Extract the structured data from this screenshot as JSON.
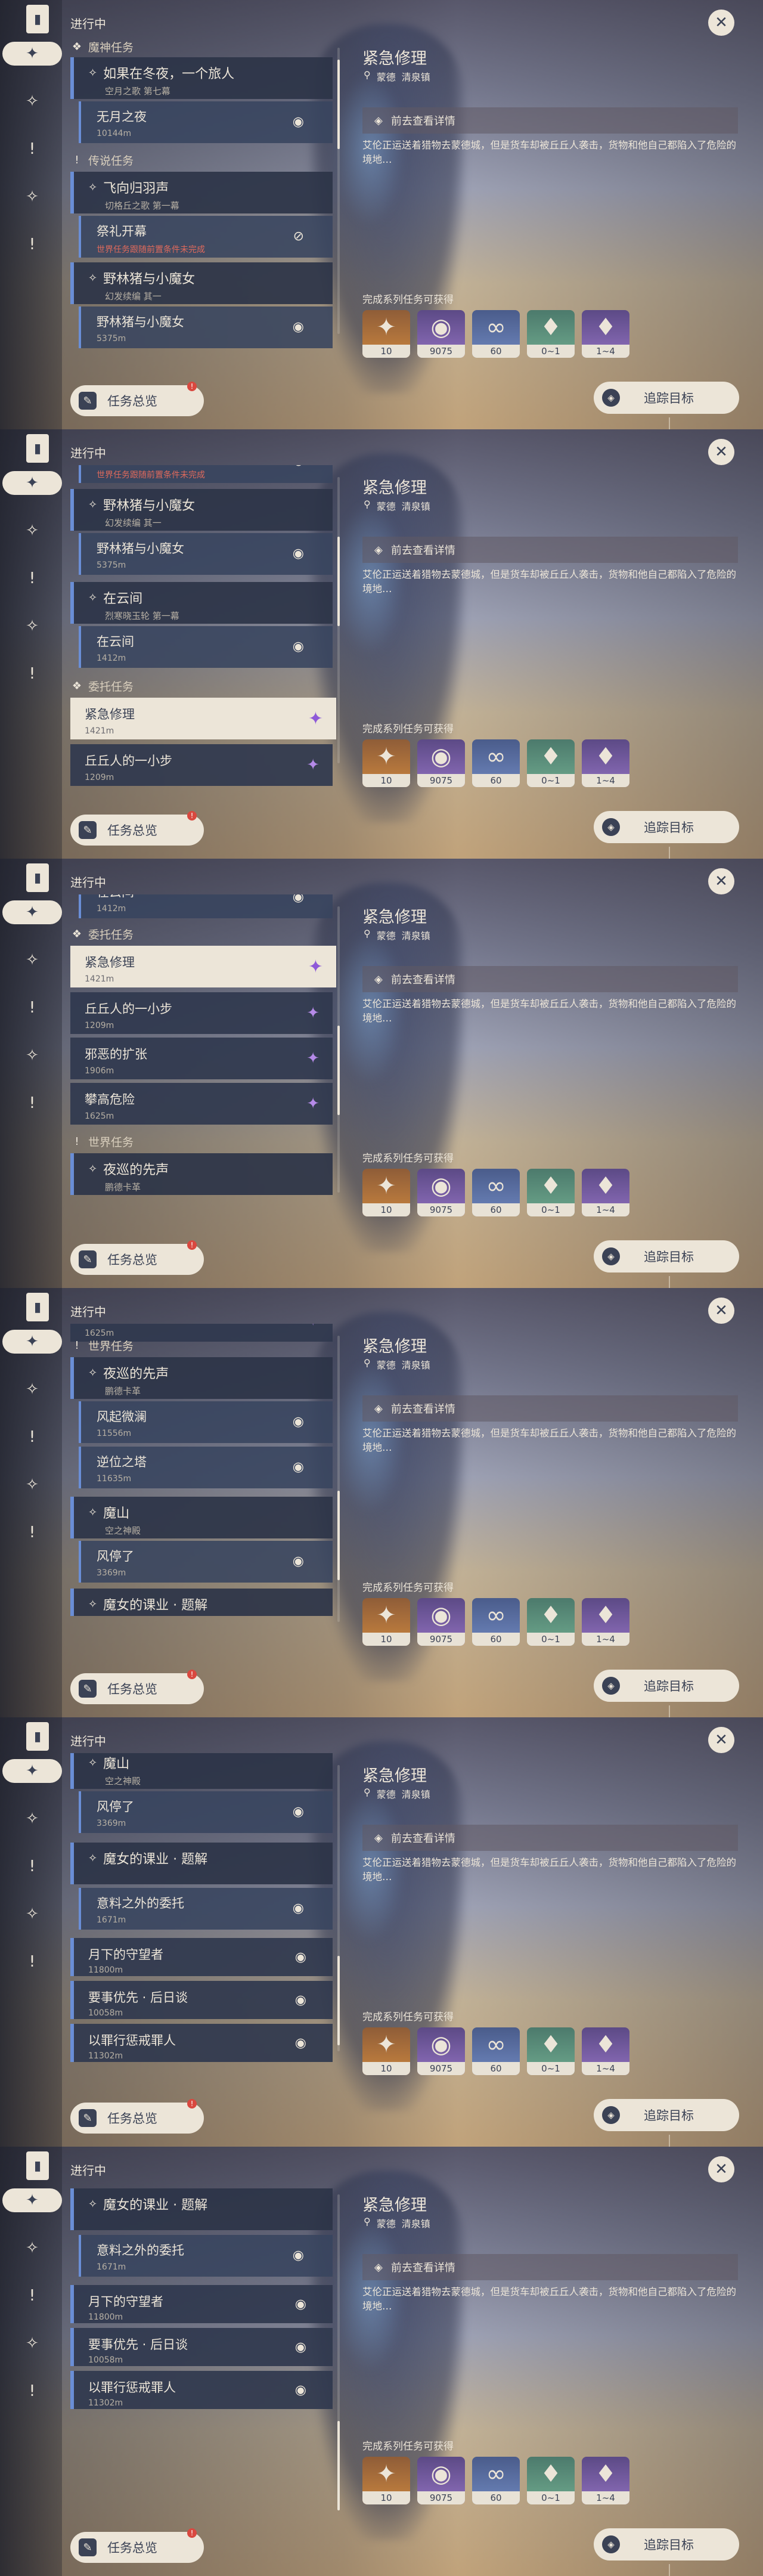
{
  "colors": {
    "cream": "#ece5d8",
    "navy": "#3b4255",
    "accent_blue": "#6a8ed6",
    "purple_pin": "#8e59d8",
    "red_warn": "#e06a5c"
  },
  "ui": {
    "status": "进行中",
    "overview_label": "任务总览",
    "overview_badge": "!",
    "track_label": "追踪目标",
    "close_glyph": "✕"
  },
  "rail_icons": [
    {
      "name": "bookmark-icon",
      "glyph": "▮"
    },
    {
      "name": "diamond-cluster-icon",
      "glyph": "✦"
    },
    {
      "name": "archon-quest-icon",
      "glyph": "✧"
    },
    {
      "name": "exclamation-icon",
      "glyph": "!"
    },
    {
      "name": "world-quest-icon",
      "glyph": "✧"
    },
    {
      "name": "exclamation-icon",
      "glyph": "!"
    }
  ],
  "detail": {
    "title": "紧急修理",
    "region": "蒙德",
    "location": "清泉镇",
    "goto": "前去查看详情",
    "desc": "艾伦正运送着猎物去蒙德城，但是货车却被丘丘人袭击，货物和他自己都陷入了危险的境地…",
    "reward_title": "完成系列任务可获得",
    "rewards": [
      {
        "name": "exp-item",
        "count": "10",
        "rarity": "5",
        "glyph": "✦"
      },
      {
        "name": "mora-coin",
        "count": "9075",
        "rarity": "4",
        "glyph": "◉"
      },
      {
        "name": "friendship-item",
        "count": "60",
        "rarity": "3",
        "glyph": "∞"
      },
      {
        "name": "crystal-small",
        "count": "0~1",
        "rarity": "2",
        "glyph": "♦"
      },
      {
        "name": "crystal-large",
        "count": "1~4",
        "rarity": "4",
        "glyph": "♦"
      }
    ]
  },
  "quests": {
    "archon_cat": "魔神任务",
    "winter_title": "如果在冬夜，一个旅人",
    "winter_sub": "空月之歌 第七幕",
    "no_night": "无月之夜",
    "no_night_dist": "10144m",
    "legend_cat": "传说任务",
    "fly_title": "飞向归羽声",
    "fly_sub": "切格丘之歌 第一幕",
    "ritual": "祭礼开幕",
    "ritual_warn": "世界任务跟随前置条件未完成",
    "boar_title": "野林猪与小魔女",
    "boar_sub": "幻发续编 其一",
    "boar_step": "野林猪与小魔女",
    "boar_dist": "5375m",
    "cloud_title": "在云间",
    "cloud_sub": "烈寒晓玉轮 第一幕",
    "cloud_step": "在云间",
    "cloud_dist": "1412m",
    "commission_cat": "委托任务",
    "repair": "紧急修理",
    "repair_dist": "1421m",
    "qiuqiu": "丘丘人的一小步",
    "qiuqiu_dist": "1209m",
    "evil": "邪恶的扩张",
    "evil_dist": "1906m",
    "climb": "攀高危险",
    "climb_dist": "1625m",
    "world_cat": "世界任务",
    "night_title": "夜巡的先声",
    "night_sub": "鹏德卡革",
    "wind": "风起微澜",
    "wind_dist": "11556m",
    "reverse": "逆位之塔",
    "reverse_dist": "11635m",
    "magic_title": "魔山",
    "magic_sub": "空之神殿",
    "wind_stop": "风停了",
    "wind_stop_dist": "3369m",
    "witch_title": "魔女的课业 · 题解",
    "unexpected": "意料之外的委托",
    "unexpected_dist": "1671m",
    "moon_guard": "月下的守望者",
    "moon_guard_dist": "11800m",
    "priority": "要事优先 · 后日谈",
    "priority_dist": "10058m",
    "sin": "以罪行惩戒罪人",
    "sin_dist": "11302m"
  }
}
